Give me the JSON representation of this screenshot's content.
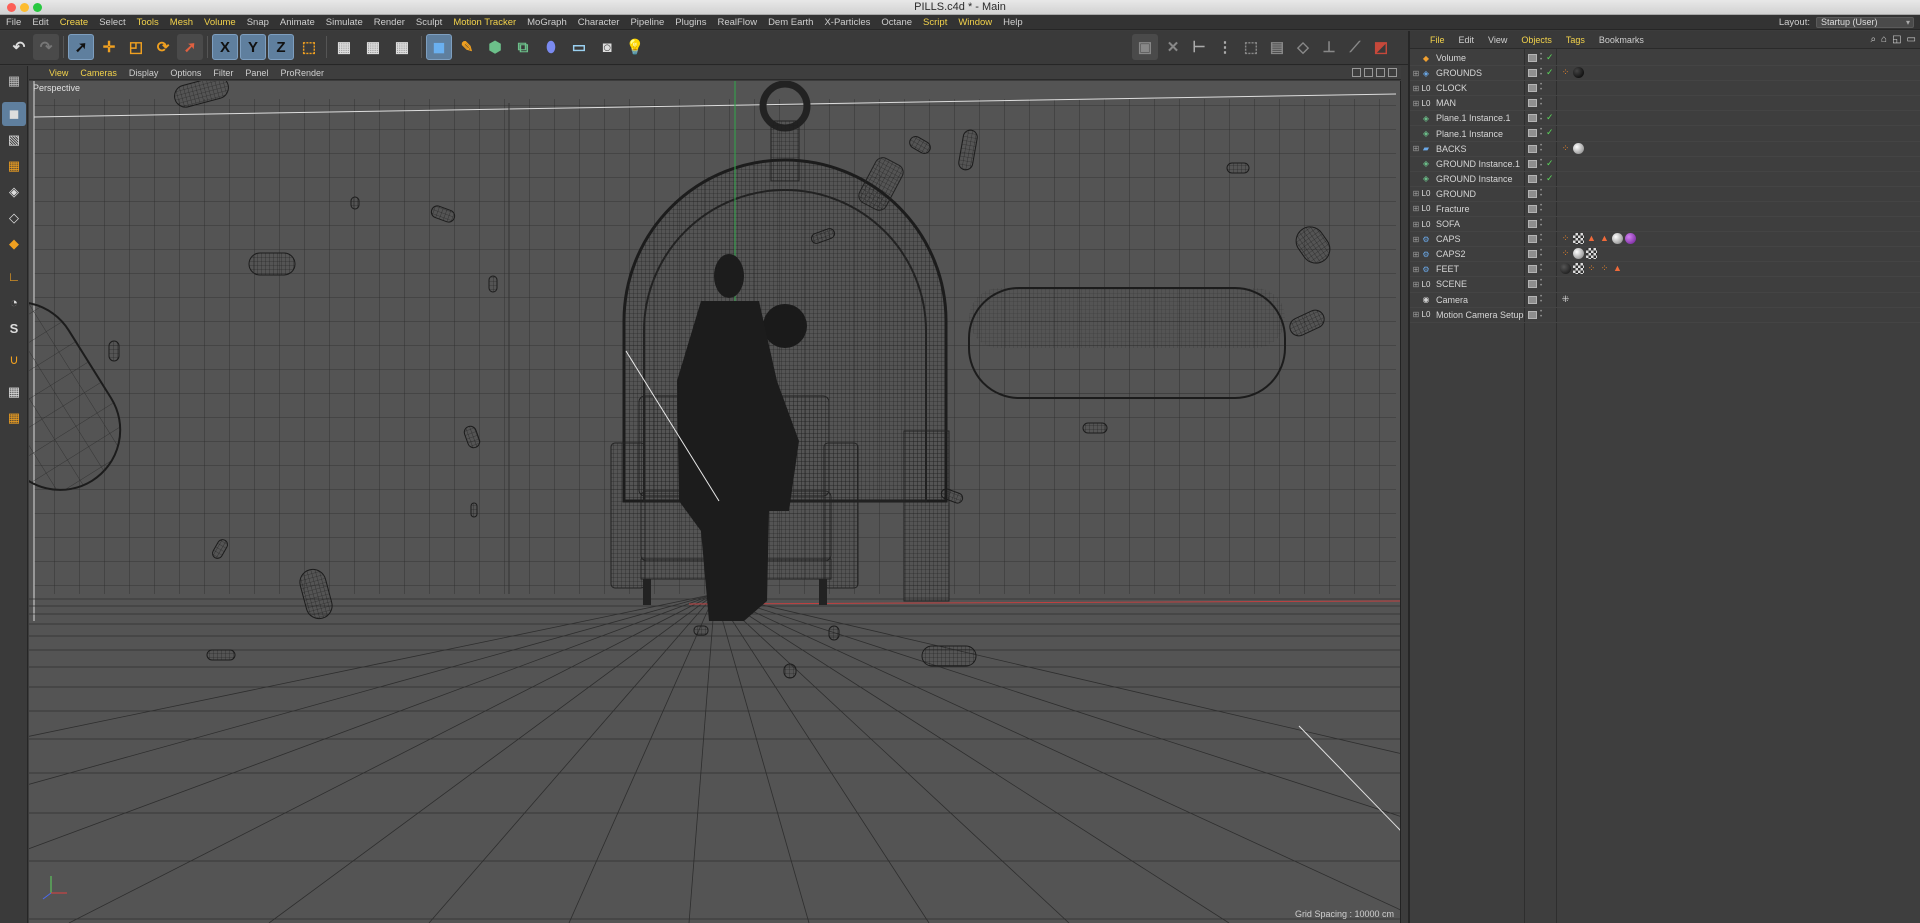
{
  "window": {
    "title": "PILLS.c4d * - Main"
  },
  "menubar": {
    "items": [
      {
        "label": "File",
        "hl": false
      },
      {
        "label": "Edit",
        "hl": false
      },
      {
        "label": "Create",
        "hl": true
      },
      {
        "label": "Select",
        "hl": false
      },
      {
        "label": "Tools",
        "hl": true
      },
      {
        "label": "Mesh",
        "hl": true
      },
      {
        "label": "Volume",
        "hl": true
      },
      {
        "label": "Snap",
        "hl": false
      },
      {
        "label": "Animate",
        "hl": false
      },
      {
        "label": "Simulate",
        "hl": false
      },
      {
        "label": "Render",
        "hl": false
      },
      {
        "label": "Sculpt",
        "hl": false
      },
      {
        "label": "Motion Tracker",
        "hl": true
      },
      {
        "label": "MoGraph",
        "hl": false
      },
      {
        "label": "Character",
        "hl": false
      },
      {
        "label": "Pipeline",
        "hl": false
      },
      {
        "label": "Plugins",
        "hl": false
      },
      {
        "label": "RealFlow",
        "hl": false
      },
      {
        "label": "Dem Earth",
        "hl": false
      },
      {
        "label": "X-Particles",
        "hl": false
      },
      {
        "label": "Octane",
        "hl": false
      },
      {
        "label": "Script",
        "hl": true
      },
      {
        "label": "Window",
        "hl": true
      },
      {
        "label": "Help",
        "hl": false
      }
    ],
    "layout_label": "Layout:",
    "layout_value": "Startup (User)"
  },
  "toolbar": {
    "axis_x": "X",
    "axis_y": "Y",
    "axis_z": "Z"
  },
  "viewport": {
    "menu": [
      {
        "label": "View",
        "hl": true
      },
      {
        "label": "Cameras",
        "hl": true
      },
      {
        "label": "Display",
        "hl": false
      },
      {
        "label": "Options",
        "hl": false
      },
      {
        "label": "Filter",
        "hl": false
      },
      {
        "label": "Panel",
        "hl": false
      },
      {
        "label": "ProRender",
        "hl": false
      }
    ],
    "projection": "Perspective",
    "grid_spacing": "Grid Spacing : 10000 cm"
  },
  "objects_panel": {
    "tabs": [
      {
        "label": "File",
        "hl": true
      },
      {
        "label": "Edit",
        "hl": false
      },
      {
        "label": "View",
        "hl": false
      },
      {
        "label": "Objects",
        "hl": true
      },
      {
        "label": "Tags",
        "hl": true
      },
      {
        "label": "Bookmarks",
        "hl": false
      }
    ],
    "rows": [
      {
        "name": "Volume",
        "icon": "volume-icon",
        "glyph": "◆",
        "color": "#f0a030",
        "expand": false,
        "check": true,
        "tags": []
      },
      {
        "name": "GROUNDS",
        "icon": "null-object-icon",
        "glyph": "◈",
        "color": "#6aa8e8",
        "expand": true,
        "check": true,
        "tags": [
          "orange-dots",
          "black-ball"
        ]
      },
      {
        "name": "CLOCK",
        "icon": "null-object-icon",
        "glyph": "L0",
        "color": "#ddd",
        "expand": true,
        "check": false,
        "tags": []
      },
      {
        "name": "MAN",
        "icon": "null-object-icon",
        "glyph": "L0",
        "color": "#ddd",
        "expand": true,
        "check": false,
        "tags": []
      },
      {
        "name": "Plane.1 Instance.1",
        "icon": "instance-icon",
        "glyph": "◈",
        "color": "#6cc08a",
        "expand": false,
        "check": true,
        "tags": []
      },
      {
        "name": "Plane.1 Instance",
        "icon": "instance-icon",
        "glyph": "◈",
        "color": "#6cc08a",
        "expand": false,
        "check": true,
        "tags": []
      },
      {
        "name": "BACKS",
        "icon": "plane-icon",
        "glyph": "▰",
        "color": "#6aa8e8",
        "expand": true,
        "check": false,
        "tags": [
          "orange-dots",
          "gray-ball"
        ]
      },
      {
        "name": "GROUND Instance.1",
        "icon": "instance-icon",
        "glyph": "◈",
        "color": "#6cc08a",
        "expand": false,
        "check": true,
        "tags": []
      },
      {
        "name": "GROUND Instance",
        "icon": "instance-icon",
        "glyph": "◈",
        "color": "#6cc08a",
        "expand": false,
        "check": true,
        "tags": []
      },
      {
        "name": "GROUND",
        "icon": "null-object-icon",
        "glyph": "L0",
        "color": "#ddd",
        "expand": true,
        "check": false,
        "tags": []
      },
      {
        "name": "Fracture",
        "icon": "null-object-icon",
        "glyph": "L0",
        "color": "#ddd",
        "expand": true,
        "check": false,
        "tags": []
      },
      {
        "name": "SOFA",
        "icon": "null-object-icon",
        "glyph": "L0",
        "color": "#ddd",
        "expand": true,
        "check": false,
        "tags": []
      },
      {
        "name": "CAPS",
        "icon": "cloner-icon",
        "glyph": "⚙",
        "color": "#6aa8e8",
        "expand": true,
        "check": false,
        "tags": [
          "orange-dots",
          "checker",
          "triangle",
          "triangle",
          "gray-ball",
          "purple-ball"
        ]
      },
      {
        "name": "CAPS2",
        "icon": "cloner-icon",
        "glyph": "⚙",
        "color": "#6aa8e8",
        "expand": true,
        "check": false,
        "tags": [
          "orange-dots",
          "gray-ball",
          "checker"
        ]
      },
      {
        "name": "FEET",
        "icon": "cloner-icon",
        "glyph": "⚙",
        "color": "#6aa8e8",
        "expand": true,
        "check": false,
        "tags": [
          "dark-ball",
          "checker",
          "orange-dots",
          "orange-dots",
          "triangle"
        ]
      },
      {
        "name": "SCENE",
        "icon": "null-object-icon",
        "glyph": "L0",
        "color": "#ddd",
        "expand": true,
        "check": false,
        "tags": []
      },
      {
        "name": "Camera",
        "icon": "camera-icon",
        "glyph": "◉",
        "color": "#cfcfcf",
        "expand": false,
        "check": false,
        "tags": [
          "camera-tag"
        ]
      },
      {
        "name": "Motion Camera Setup",
        "icon": "null-object-icon",
        "glyph": "L0",
        "color": "#ddd",
        "expand": true,
        "check": false,
        "tags": []
      }
    ]
  }
}
